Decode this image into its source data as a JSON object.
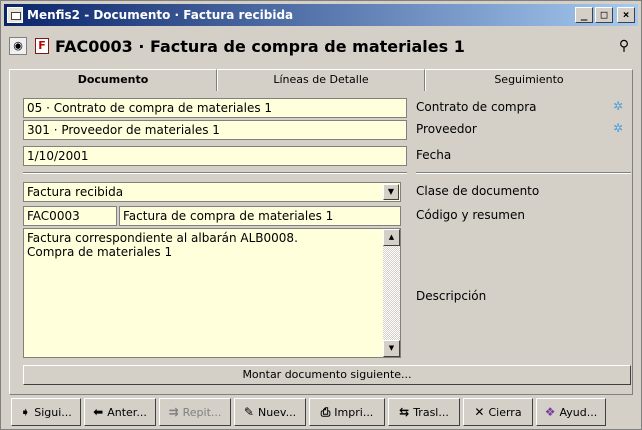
{
  "window": {
    "title": "Menfis2 - Documento · Factura recibida"
  },
  "titlebar_buttons": {
    "minimize": "_",
    "maximize": "□",
    "close": "×"
  },
  "header": {
    "doc_type_letter": "F",
    "title": "FAC0003 · Factura de compra de materiales 1"
  },
  "tabs": [
    {
      "label": "Documento",
      "active": true
    },
    {
      "label": "Líneas de Detalle",
      "active": false
    },
    {
      "label": "Seguimiento",
      "active": false
    }
  ],
  "fields": {
    "contrato": {
      "value": "05 · Contrato de compra de materiales 1",
      "label": "Contrato de compra"
    },
    "proveedor": {
      "value": "301 · Proveedor de materiales 1",
      "label": "Proveedor"
    },
    "fecha": {
      "value": "1/10/2001",
      "label": "Fecha"
    },
    "clase": {
      "value": "Factura recibida",
      "label": "Clase de documento"
    },
    "codigo": {
      "value": "FAC0003",
      "resumen": "Factura de compra de materiales 1",
      "label": "Código y resumen"
    },
    "descripcion": {
      "lines": [
        "Factura correspondiente al albarán ALB0008.",
        "Compra de materiales 1"
      ],
      "label": "Descripción"
    }
  },
  "montar_button": "Montar documento siguiente...",
  "toolbar": [
    {
      "label": "Sigui...",
      "icon": "arrow-right-icon",
      "glyph": "➧",
      "enabled": true
    },
    {
      "label": "Anter...",
      "icon": "arrow-left-icon",
      "glyph": "⬅",
      "enabled": true
    },
    {
      "label": "Repit...",
      "icon": "repeat-icon",
      "glyph": "⇉",
      "enabled": false
    },
    {
      "label": "Nuev...",
      "icon": "new-document-icon",
      "glyph": "✎",
      "enabled": true
    },
    {
      "label": "Impri...",
      "icon": "printer-icon",
      "glyph": "⎙",
      "enabled": true
    },
    {
      "label": "Trasl...",
      "icon": "transfer-icon",
      "glyph": "⇆",
      "enabled": true
    },
    {
      "label": "Cierra",
      "icon": "close-icon",
      "glyph": "✕",
      "enabled": true
    },
    {
      "label": "Ayud...",
      "icon": "help-book-icon",
      "glyph": "❖",
      "enabled": true
    }
  ],
  "colors": {
    "field_background": "#ffffdc",
    "titlebar_start": "#0a246a",
    "titlebar_end": "#a6caf0",
    "doc_type_icon": "#c00000",
    "link_icon": "#4fa0d8"
  }
}
